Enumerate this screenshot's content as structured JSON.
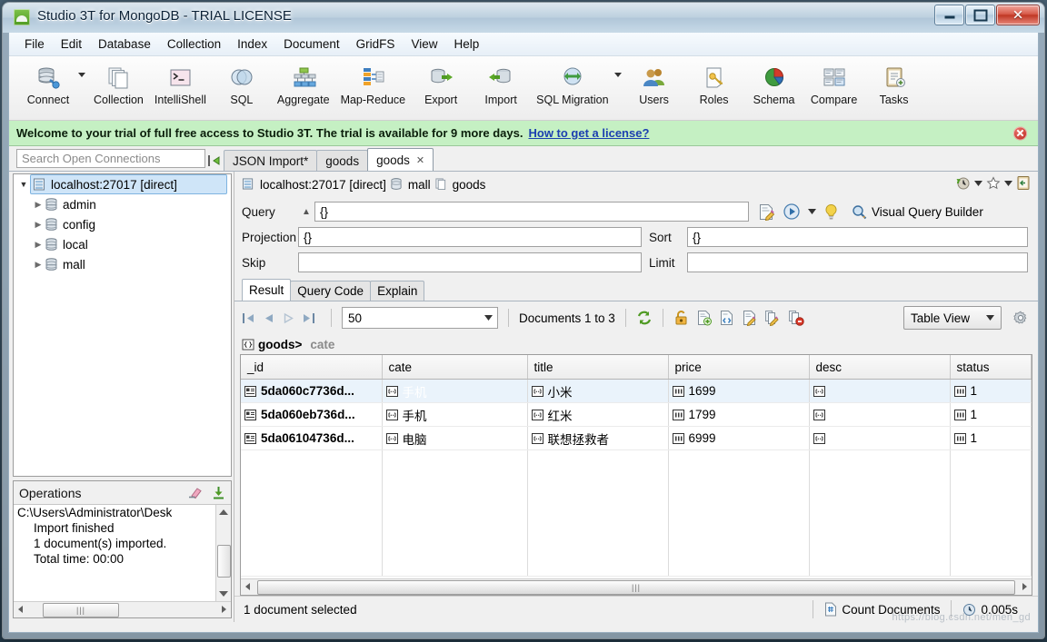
{
  "window": {
    "title": "Studio 3T for MongoDB - TRIAL LICENSE",
    "minimize_label": "Minimize",
    "maximize_label": "Maximize",
    "close_label": "✕"
  },
  "menu": {
    "items": [
      "File",
      "Edit",
      "Database",
      "Collection",
      "Index",
      "Document",
      "GridFS",
      "View",
      "Help"
    ]
  },
  "toolbar": {
    "buttons": [
      {
        "label": "Connect",
        "icon": "connect-database-icon",
        "has_dropdown": true
      },
      {
        "label": "Collection",
        "icon": "collection-icon",
        "has_dropdown": false
      },
      {
        "label": "IntelliShell",
        "icon": "intellishell-icon",
        "has_dropdown": false
      },
      {
        "label": "SQL",
        "icon": "sql-icon",
        "has_dropdown": false
      },
      {
        "label": "Aggregate",
        "icon": "aggregate-icon",
        "has_dropdown": false
      },
      {
        "label": "Map-Reduce",
        "icon": "map-reduce-icon",
        "has_dropdown": false
      },
      {
        "label": "Export",
        "icon": "export-icon",
        "has_dropdown": false
      },
      {
        "label": "Import",
        "icon": "import-icon",
        "has_dropdown": false
      },
      {
        "label": "SQL Migration",
        "icon": "sql-migration-icon",
        "has_dropdown": true
      },
      {
        "label": "Users",
        "icon": "users-icon",
        "has_dropdown": false
      },
      {
        "label": "Roles",
        "icon": "roles-icon",
        "has_dropdown": false
      },
      {
        "label": "Schema",
        "icon": "schema-pie-icon",
        "has_dropdown": false
      },
      {
        "label": "Compare",
        "icon": "compare-icon",
        "has_dropdown": false
      },
      {
        "label": "Tasks",
        "icon": "tasks-icon",
        "has_dropdown": false
      }
    ]
  },
  "trial_bar": {
    "message": "Welcome to your trial of full free access to Studio 3T. The trial is available for 9 more days.",
    "link": "How to get a license?",
    "close_icon": "close-notification-icon",
    "background": "#c5f0c3"
  },
  "tabs": {
    "search_placeholder": "Search Open Connections",
    "items": [
      {
        "label": "JSON Import*",
        "active": false,
        "closable": false
      },
      {
        "label": "goods",
        "active": false,
        "closable": false
      },
      {
        "label": "goods",
        "active": true,
        "closable": true
      }
    ]
  },
  "sidebar": {
    "tree": [
      {
        "label": "localhost:27017 [direct]",
        "level": 0,
        "expanded": true,
        "selected": true,
        "icon": "server-icon"
      },
      {
        "label": "admin",
        "level": 1,
        "expanded": false,
        "selected": false,
        "icon": "database-icon"
      },
      {
        "label": "config",
        "level": 1,
        "expanded": false,
        "selected": false,
        "icon": "database-icon"
      },
      {
        "label": "local",
        "level": 1,
        "expanded": false,
        "selected": false,
        "icon": "database-icon"
      },
      {
        "label": "mall",
        "level": 1,
        "expanded": false,
        "selected": false,
        "icon": "database-icon"
      }
    ]
  },
  "operations": {
    "title": "Operations",
    "clear_icon": "eraser-icon",
    "download_icon": "download-icon",
    "lines": [
      {
        "text": "C:\\Users\\Administrator\\Desk",
        "indent": false
      },
      {
        "text": "Import finished",
        "indent": true
      },
      {
        "text": "1 document(s) imported.",
        "indent": true
      },
      {
        "text": "Total time: 00:00",
        "indent": true
      }
    ]
  },
  "breadcrumb": {
    "server": "localhost:27017 [direct]",
    "database": "mall",
    "collection": "goods",
    "tools": [
      "history-icon",
      "chevron-down-icon",
      "favorite-star-icon",
      "chevron-down-icon",
      "clipboard-icon"
    ]
  },
  "query_panel": {
    "query_label": "Query",
    "query_value": "{}",
    "projection_label": "Projection",
    "projection_value": "{}",
    "sort_label": "Sort",
    "sort_value": "{}",
    "skip_label": "Skip",
    "skip_value": "",
    "limit_label": "Limit",
    "limit_value": "",
    "edit_icon": "edit-query-icon",
    "run_icon": "run-query-icon",
    "run_dropdown_icon": "chevron-down-icon",
    "hint_icon": "lightbulb-icon",
    "visual_query_builder": "Visual Query Builder",
    "vqb_icon": "visual-query-builder-icon"
  },
  "result": {
    "tabs": [
      {
        "label": "Result",
        "active": true
      },
      {
        "label": "Query Code",
        "active": false
      },
      {
        "label": "Explain",
        "active": false
      }
    ],
    "page_size": "50",
    "documents_status": "Documents 1 to 3",
    "refresh_icon": "refresh-icon",
    "action_icons": [
      "lock-icon",
      "add-document-icon",
      "add-json-document-icon",
      "edit-document-icon",
      "edit-multiple-documents-icon",
      "delete-document-icon"
    ],
    "view_mode": "Table View",
    "settings_icon": "gear-icon",
    "path_collection": "goods>",
    "path_field": "cate",
    "columns": [
      "_id",
      "cate",
      "title",
      "price",
      "desc",
      "status"
    ],
    "rows": [
      {
        "_id": "5da060c7736d...",
        "cate": "手机",
        "title": "小米",
        "price": "1699",
        "desc": "",
        "status": "1",
        "selected_column": "cate",
        "row_selected": true
      },
      {
        "_id": "5da060eb736d...",
        "cate": "手机",
        "title": "红米",
        "price": "1799",
        "desc": "",
        "status": "1",
        "selected_column": "",
        "row_selected": false
      },
      {
        "_id": "5da06104736d...",
        "cate": "电脑",
        "title": "联想拯救者",
        "price": "6999",
        "desc": "",
        "status": "1",
        "selected_column": "",
        "row_selected": false
      }
    ]
  },
  "status_bar": {
    "selection": "1 document selected",
    "count_documents": "Count Documents",
    "count_icon": "count-documents-icon",
    "elapsed": "0.005s",
    "clock_icon": "clock-icon",
    "watermark": "https://blog.csdn.net/men_gd"
  },
  "colors": {
    "selection_blue": "#1e90ff",
    "trial_green": "#c5f0c3",
    "link_blue": "#1c3fb0"
  }
}
